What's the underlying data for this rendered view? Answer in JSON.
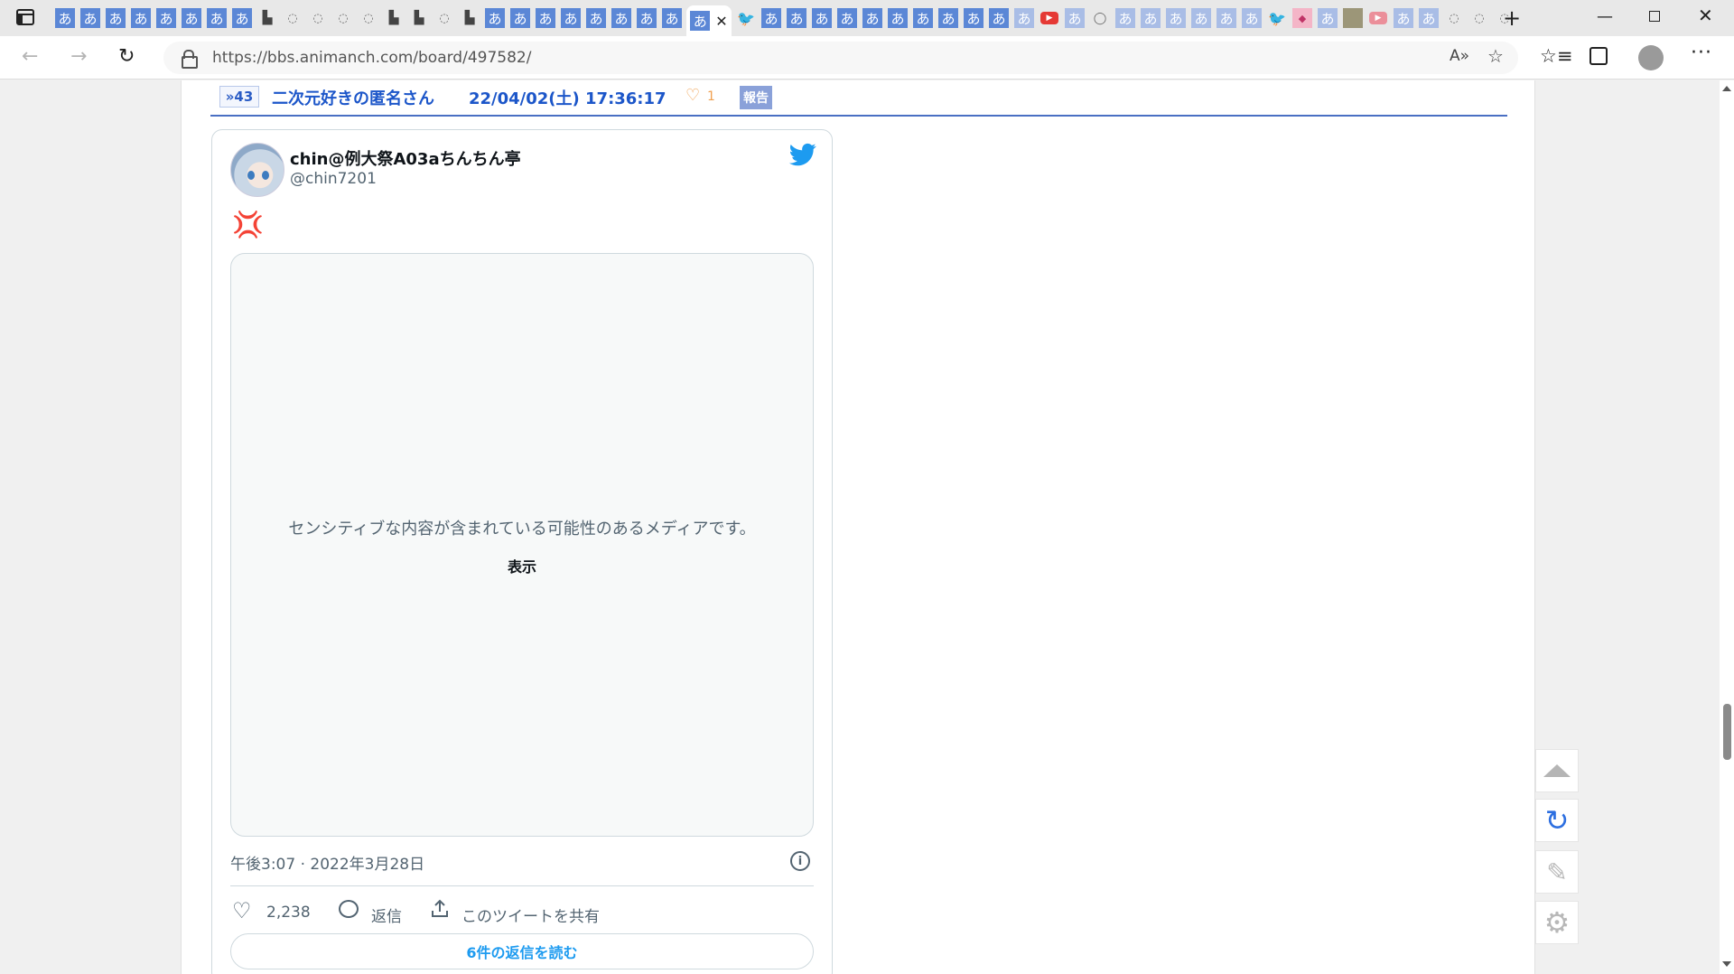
{
  "browser": {
    "tabs": [
      {
        "icon": "hiragana-a-icon",
        "glyph": "あ",
        "style": "blue"
      },
      {
        "icon": "hiragana-a-icon",
        "glyph": "あ",
        "style": "blue"
      },
      {
        "icon": "hiragana-a-icon",
        "glyph": "あ",
        "style": "blue"
      },
      {
        "icon": "hiragana-a-icon",
        "glyph": "あ",
        "style": "blue"
      },
      {
        "icon": "hiragana-a-icon",
        "glyph": "あ",
        "style": "blue"
      },
      {
        "icon": "hiragana-a-icon",
        "glyph": "あ",
        "style": "blue"
      },
      {
        "icon": "hiragana-a-icon",
        "glyph": "あ",
        "style": "blue"
      },
      {
        "icon": "hiragana-a-icon",
        "glyph": "あ",
        "style": "blue"
      },
      {
        "icon": "puzzle-icon",
        "glyph": "▙",
        "style": "dark"
      },
      {
        "icon": "cat-face-icon",
        "glyph": "◌",
        "style": "gray"
      },
      {
        "icon": "cat-face-icon",
        "glyph": "◌",
        "style": "gray"
      },
      {
        "icon": "cat-face-icon",
        "glyph": "◌",
        "style": "gray"
      },
      {
        "icon": "cat-face-icon",
        "glyph": "◌",
        "style": "gray"
      },
      {
        "icon": "puzzle-icon",
        "glyph": "▙",
        "style": "dark"
      },
      {
        "icon": "puzzle-icon",
        "glyph": "▙",
        "style": "dark"
      },
      {
        "icon": "cat-face-icon",
        "glyph": "◌",
        "style": "gray"
      },
      {
        "icon": "puzzle-icon",
        "glyph": "▙",
        "style": "dark"
      },
      {
        "icon": "hiragana-a-icon",
        "glyph": "あ",
        "style": "blue"
      },
      {
        "icon": "hiragana-a-icon",
        "glyph": "あ",
        "style": "blue"
      },
      {
        "icon": "hiragana-a-icon",
        "glyph": "あ",
        "style": "blue"
      },
      {
        "icon": "hiragana-a-icon",
        "glyph": "あ",
        "style": "blue"
      },
      {
        "icon": "hiragana-a-icon",
        "glyph": "あ",
        "style": "blue"
      },
      {
        "icon": "hiragana-a-icon",
        "glyph": "あ",
        "style": "blue"
      },
      {
        "icon": "hiragana-a-icon",
        "glyph": "あ",
        "style": "blue"
      },
      {
        "icon": "hiragana-a-icon",
        "glyph": "あ",
        "style": "blue"
      },
      {
        "icon": "hiragana-a-icon",
        "glyph": "あ",
        "style": "blue",
        "active": true
      },
      {
        "icon": "twitter-bird-icon",
        "glyph": "🐦",
        "style": "tw"
      },
      {
        "icon": "hiragana-a-icon",
        "glyph": "あ",
        "style": "blue"
      },
      {
        "icon": "hiragana-a-icon",
        "glyph": "あ",
        "style": "blue"
      },
      {
        "icon": "hiragana-a-icon",
        "glyph": "あ",
        "style": "blue"
      },
      {
        "icon": "hiragana-a-icon",
        "glyph": "あ",
        "style": "blue"
      },
      {
        "icon": "hiragana-a-icon",
        "glyph": "あ",
        "style": "blue"
      },
      {
        "icon": "hiragana-a-icon",
        "glyph": "あ",
        "style": "blue"
      },
      {
        "icon": "hiragana-a-icon",
        "glyph": "あ",
        "style": "blue"
      },
      {
        "icon": "hiragana-a-icon",
        "glyph": "あ",
        "style": "blue"
      },
      {
        "icon": "hiragana-a-icon",
        "glyph": "あ",
        "style": "blue"
      },
      {
        "icon": "hiragana-a-icon",
        "glyph": "あ",
        "style": "blue"
      },
      {
        "icon": "hiragana-a-icon",
        "glyph": "あ",
        "style": "pale"
      },
      {
        "icon": "youtube-icon",
        "glyph": "▶",
        "style": "yt"
      },
      {
        "icon": "hiragana-a-icon",
        "glyph": "あ",
        "style": "pale"
      },
      {
        "icon": "circle-arrow-icon",
        "glyph": "◯",
        "style": "gray"
      },
      {
        "icon": "hiragana-a-icon",
        "glyph": "あ",
        "style": "pale"
      },
      {
        "icon": "hiragana-a-icon",
        "glyph": "あ",
        "style": "pale"
      },
      {
        "icon": "hiragana-a-icon",
        "glyph": "あ",
        "style": "pale"
      },
      {
        "icon": "hiragana-a-icon",
        "glyph": "あ",
        "style": "pale"
      },
      {
        "icon": "hiragana-a-icon",
        "glyph": "あ",
        "style": "pale"
      },
      {
        "icon": "hiragana-a-icon",
        "glyph": "あ",
        "style": "pale"
      },
      {
        "icon": "twitter-bird-icon",
        "glyph": "🐦",
        "style": "tw"
      },
      {
        "icon": "pink-app-icon",
        "glyph": "◆",
        "style": "pink"
      },
      {
        "icon": "hiragana-a-icon",
        "glyph": "あ",
        "style": "pale"
      },
      {
        "icon": "image-thumb-icon",
        "glyph": "",
        "style": "img"
      },
      {
        "icon": "youtube-icon",
        "glyph": "▶",
        "style": "ytp"
      },
      {
        "icon": "hiragana-a-icon",
        "glyph": "あ",
        "style": "pale"
      },
      {
        "icon": "hiragana-a-icon",
        "glyph": "あ",
        "style": "pale"
      },
      {
        "icon": "cat-face-icon",
        "glyph": "◌",
        "style": "gray"
      },
      {
        "icon": "cat-face-icon",
        "glyph": "◌",
        "style": "gray"
      },
      {
        "icon": "cat-face-icon",
        "glyph": "◌",
        "style": "gray"
      }
    ],
    "new_tab": "+",
    "window": {
      "minimize": "—",
      "close": "✕"
    },
    "nav": {
      "back": "←",
      "forward": "→",
      "reload": "↻"
    },
    "url": "https://bbs.animanch.com/board/497582/",
    "toolbar": {
      "read_aloud": "A»",
      "add_favorite": "☆",
      "favorites": "☆≡",
      "menu": "···"
    }
  },
  "post": {
    "reply_number": "»43",
    "author": "二次元好きの匿名さん",
    "timestamp": "22/04/02(土) 17:36:17",
    "like_icon": "♡",
    "like_count": "1",
    "report": "報告"
  },
  "tweet": {
    "display_name": "chin@例大祭A03aちんちん亭",
    "handle": "@chin7201",
    "text": "💢",
    "sensitive_message": "センシティブな内容が含まれている可能性のあるメディアです。",
    "show_label": "表示",
    "time": "午後3:07 · 2022年3月28日",
    "info": "i",
    "likes": "2,238",
    "reply_label": "返信",
    "share_label": "このツイートを共有",
    "read_replies": "6件の返信を読む",
    "colors": {
      "accent": "#1d9bf0",
      "text": "#0f1419",
      "muted": "#536471"
    }
  },
  "floating": {
    "refresh": "↻",
    "edit": "✎",
    "settings": "⚙"
  },
  "colors": {
    "board_blue": "#1c56c9",
    "report_bg": "#8aa1d9",
    "like_orange": "#f0a050"
  }
}
